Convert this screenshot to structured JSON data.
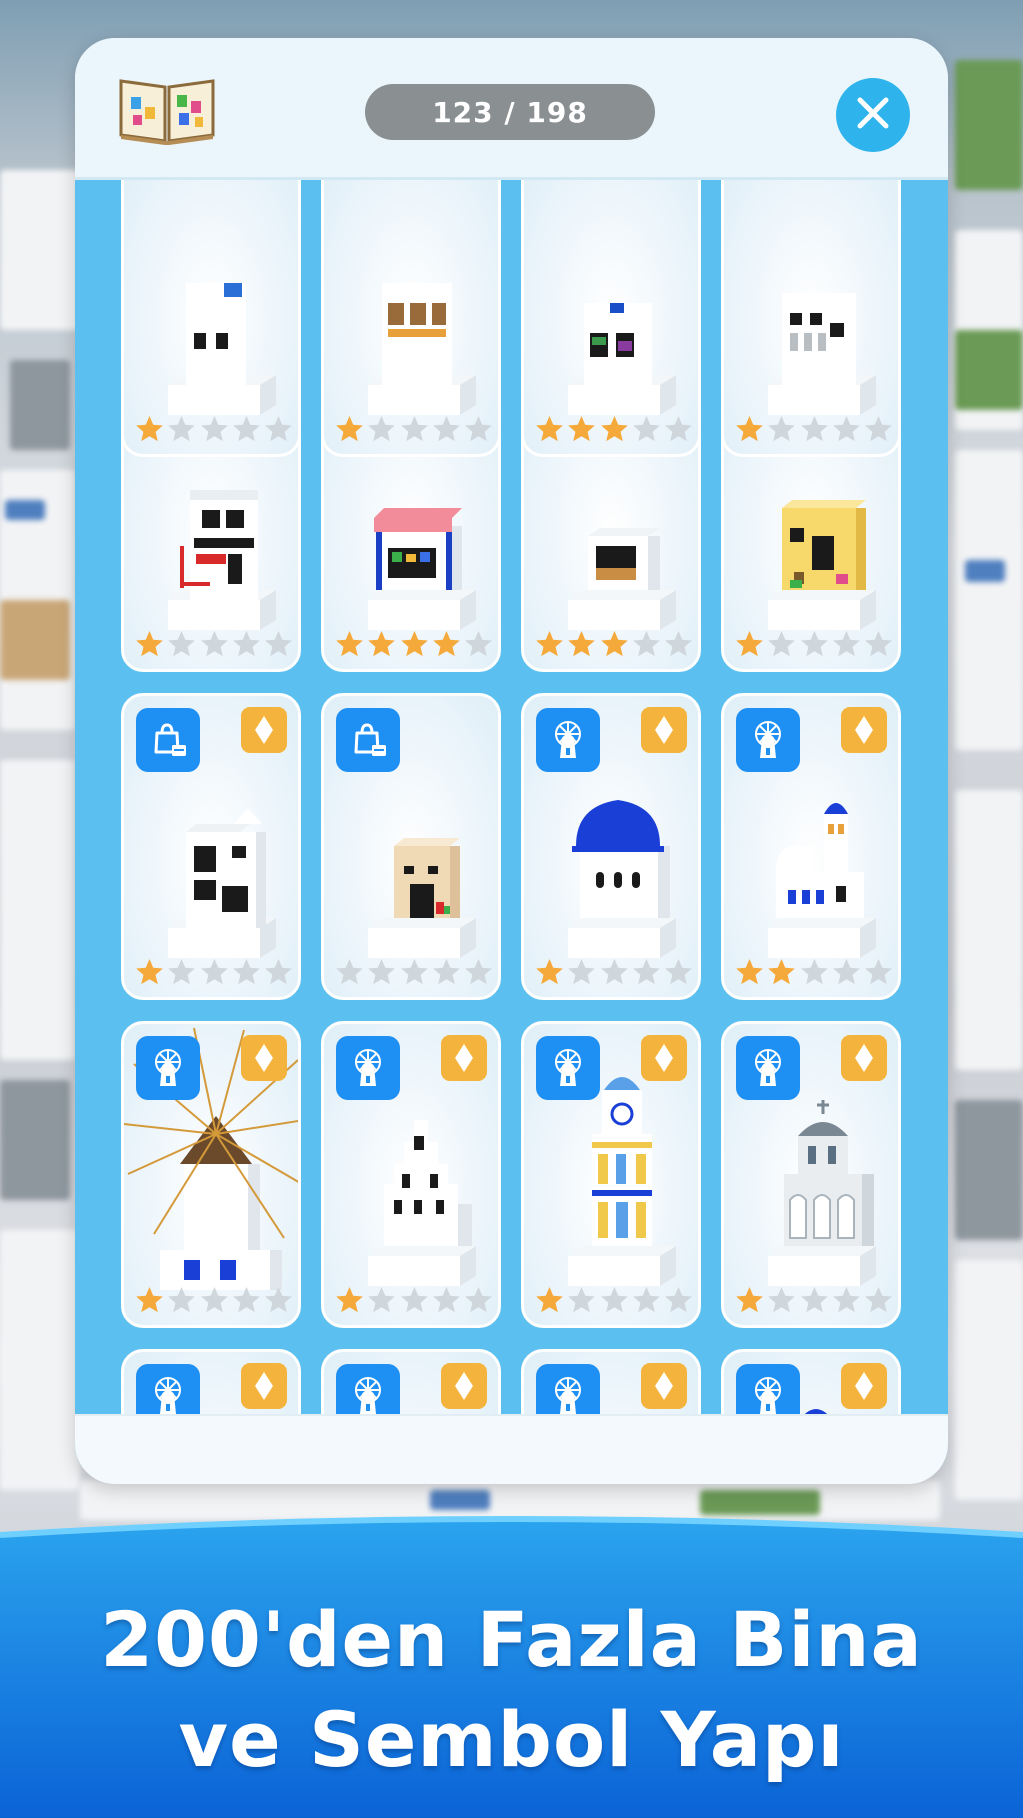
{
  "app": {
    "progress_counter": "123 / 198"
  },
  "header": {
    "collection_icon": "book-icon",
    "close_icon": "close-icon"
  },
  "colors": {
    "accent_blue": "#1e8ff3",
    "close_blue": "#2fb3ec",
    "star_filled": "#f5a93b",
    "star_empty": "#cfd6dc",
    "gem_badge": "#f4b33c",
    "grid_bg": "#5bbff0"
  },
  "cards": [
    {
      "category": null,
      "gem": false,
      "stars": 1,
      "building": "house-partial"
    },
    {
      "category": null,
      "gem": false,
      "stars": 1,
      "building": "shop-partial"
    },
    {
      "category": null,
      "gem": false,
      "stars": 3,
      "building": "store-partial"
    },
    {
      "category": null,
      "gem": false,
      "stars": 1,
      "building": "cafe-partial"
    },
    {
      "category": "shop-icon",
      "gem": false,
      "stars": 1,
      "building": "awning-shop"
    },
    {
      "category": "shop-icon",
      "gem": false,
      "stars": 4,
      "building": "pink-roof-store"
    },
    {
      "category": "shop-icon",
      "gem": false,
      "stars": 3,
      "building": "small-garage"
    },
    {
      "category": "shop-icon",
      "gem": false,
      "stars": 1,
      "building": "yellow-house"
    },
    {
      "category": "shop-icon",
      "gem": true,
      "stars": 1,
      "building": "dark-window-house"
    },
    {
      "category": "shop-icon",
      "gem": false,
      "stars": 0,
      "building": "beige-house"
    },
    {
      "category": "windmill-icon",
      "gem": true,
      "stars": 1,
      "building": "blue-dome-church"
    },
    {
      "category": "windmill-icon",
      "gem": true,
      "stars": 2,
      "building": "bell-tower-church"
    },
    {
      "category": "windmill-icon",
      "gem": true,
      "stars": 1,
      "building": "windmill"
    },
    {
      "category": "windmill-icon",
      "gem": true,
      "stars": 1,
      "building": "bell-gable"
    },
    {
      "category": "windmill-icon",
      "gem": true,
      "stars": 1,
      "building": "clock-tower"
    },
    {
      "category": "windmill-icon",
      "gem": true,
      "stars": 1,
      "building": "grey-dome-church"
    },
    {
      "category": "windmill-icon",
      "gem": true,
      "stars": null,
      "building": "empty"
    },
    {
      "category": "windmill-icon",
      "gem": true,
      "stars": null,
      "building": "small-blue-dome"
    },
    {
      "category": "windmill-icon",
      "gem": true,
      "stars": null,
      "building": "empty"
    },
    {
      "category": "windmill-icon",
      "gem": true,
      "stars": null,
      "building": "blue-dome-tower"
    }
  ],
  "banner": {
    "line1": "200'den Fazla Bina",
    "line2": "ve Sembol Yapı"
  }
}
